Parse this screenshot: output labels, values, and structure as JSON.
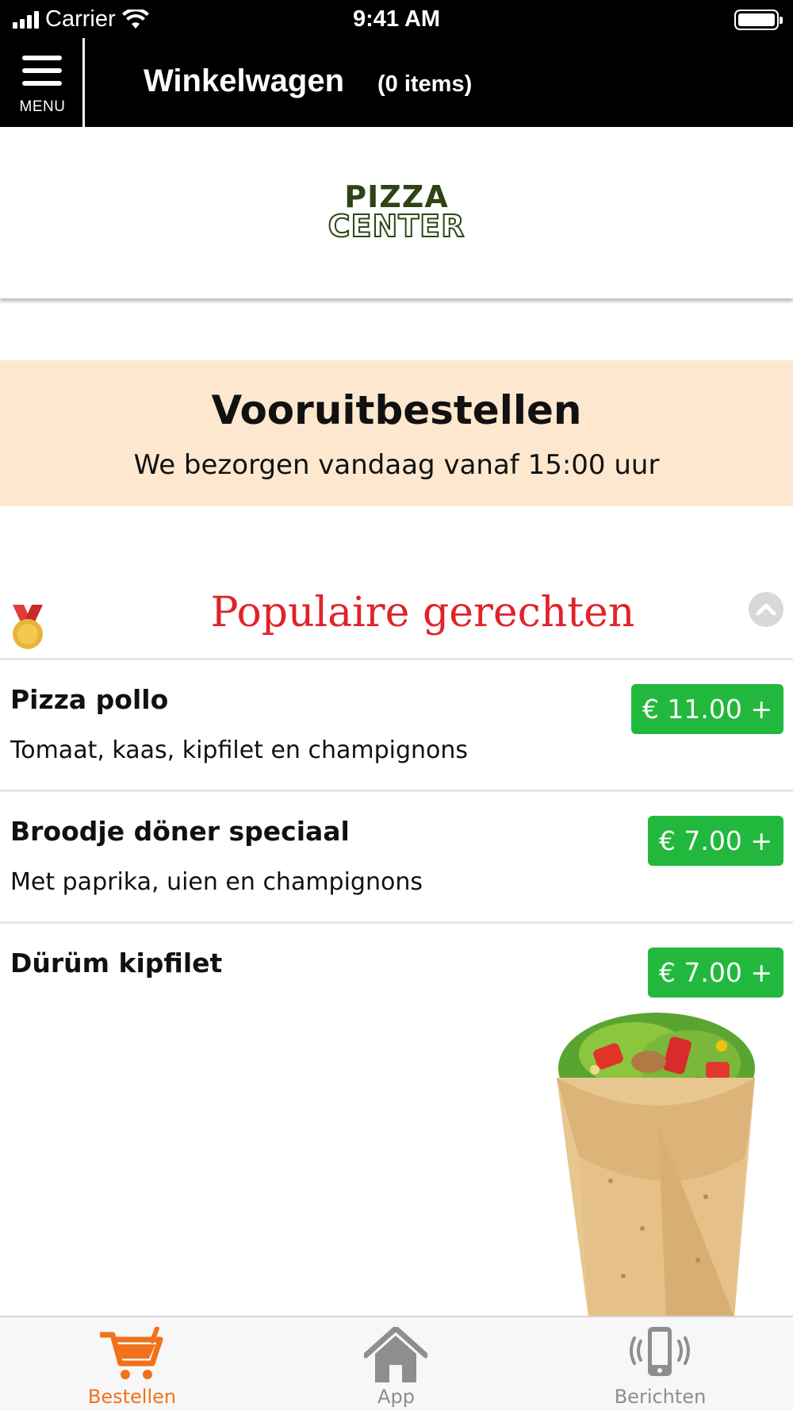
{
  "status_bar": {
    "carrier": "Carrier",
    "time": "9:41 AM"
  },
  "header": {
    "menu_label": "MENU",
    "title": "Winkelwagen",
    "item_count": "(0 items)"
  },
  "logo": {
    "line1": "PIZZA",
    "line2": "CENTER"
  },
  "banner": {
    "title": "Vooruitbestellen",
    "subtitle": "We bezorgen vandaag vanaf 15:00 uur"
  },
  "section": {
    "title": "Populaire gerechten"
  },
  "items": [
    {
      "name": "Pizza pollo",
      "description": "Tomaat, kaas, kipfilet en champignons",
      "price": "€ 11.00 +"
    },
    {
      "name": "Broodje döner speciaal",
      "description": "Met paprika, uien en champignons",
      "price": "€ 7.00 +"
    },
    {
      "name": "Dürüm kipfilet",
      "description": "",
      "price": "€ 7.00 +"
    }
  ],
  "tabs": [
    {
      "label": "Bestellen",
      "icon": "cart-icon",
      "active": true
    },
    {
      "label": "App",
      "icon": "home-icon",
      "active": false
    },
    {
      "label": "Berichten",
      "icon": "phone-vibrate-icon",
      "active": false
    }
  ],
  "colors": {
    "accent": "#f2711c",
    "price_green": "#22b83d",
    "section_red": "#e0232a",
    "banner_bg": "#fde8cf",
    "tab_inactive": "#8e8e8e"
  }
}
